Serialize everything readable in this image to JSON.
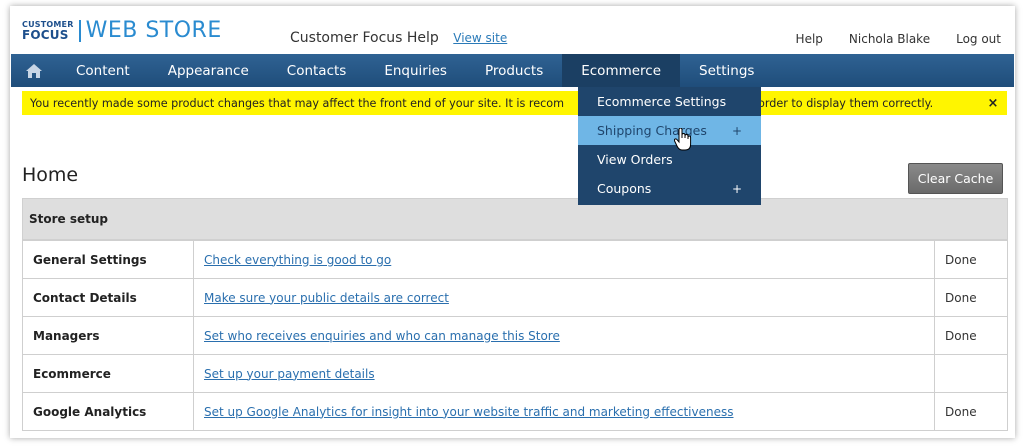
{
  "header": {
    "logo_small_top": "CUSTOMER",
    "logo_small_bottom": "FOCUS",
    "logo_main": "WEB STORE",
    "site_title": "Customer Focus Help",
    "view_site": "View site",
    "links": [
      "Help",
      "Nichola Blake",
      "Log out"
    ]
  },
  "nav": {
    "home_icon": "home-icon",
    "items": [
      "Content",
      "Appearance",
      "Contacts",
      "Enquiries",
      "Products",
      "Ecommerce",
      "Settings"
    ],
    "active": "Ecommerce"
  },
  "alert": {
    "text_left": "You recently made some product changes that may affect the front end of your site. It is recom",
    "text_right": "order to display them correctly.",
    "close": "×"
  },
  "dropdown": {
    "items": [
      {
        "label": "Ecommerce Settings",
        "plus": ""
      },
      {
        "label": "Shipping Charges",
        "plus": "+"
      },
      {
        "label": "View Orders",
        "plus": ""
      },
      {
        "label": "Coupons",
        "plus": "+"
      }
    ],
    "hovered": "Shipping Charges"
  },
  "page": {
    "title": "Home",
    "clear_cache": "Clear Cache"
  },
  "store": {
    "heading": "Store setup",
    "rows": [
      {
        "name": "General Settings",
        "link": "Check everything is good to go",
        "status": "Done"
      },
      {
        "name": "Contact Details",
        "link": "Make sure your public details are correct",
        "status": "Done"
      },
      {
        "name": "Managers",
        "link": "Set who receives enquiries and who can manage this Store",
        "status": "Done"
      },
      {
        "name": "Ecommerce",
        "link": "Set up your payment details",
        "status": ""
      },
      {
        "name": "Google Analytics",
        "link": "Set up Google Analytics for insight into your website traffic and marketing effectiveness",
        "status": "Done"
      }
    ]
  }
}
